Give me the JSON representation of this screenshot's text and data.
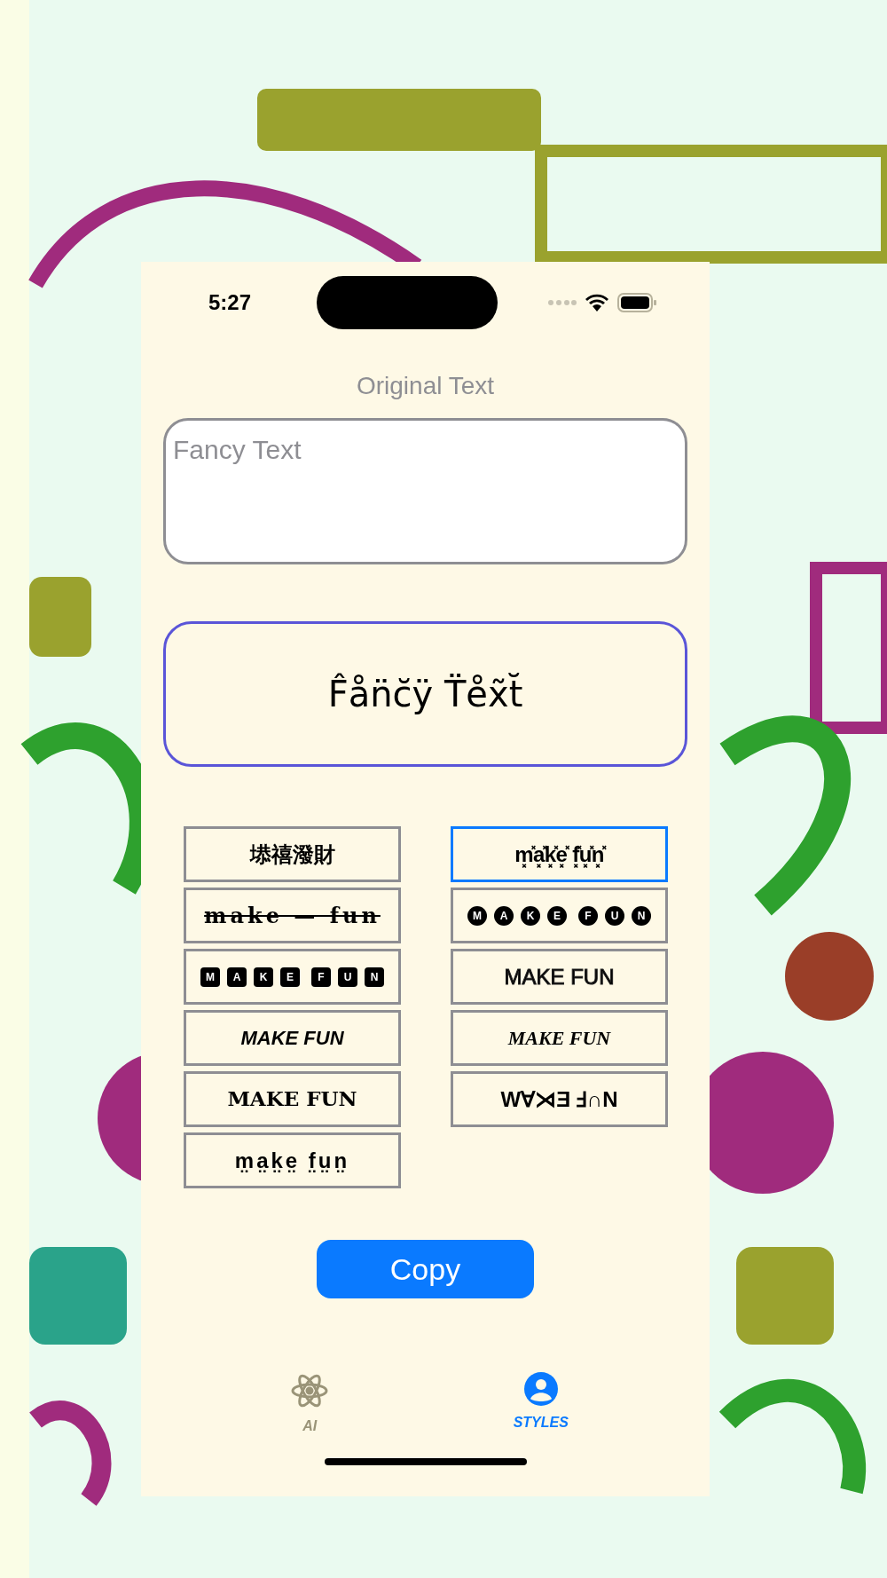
{
  "status_bar": {
    "time": "5:27"
  },
  "original_label": "Original Text",
  "input": {
    "placeholder": "Fancy Text"
  },
  "output": "F̂ån̈c̆ÿ T̈e̊x̃t̆",
  "styles": [
    {
      "kind": "cjk",
      "text": "塨禧潑財",
      "selected": false
    },
    {
      "kind": "strike",
      "text": "make — fun",
      "selected": false
    },
    {
      "kind": "squared",
      "text": "M A K E  F U N",
      "selected": false
    },
    {
      "kind": "italic",
      "text": "MAKE FUN",
      "selected": false
    },
    {
      "kind": "blackletter",
      "text": "MAKE FUN",
      "selected": false
    },
    {
      "kind": "dotted",
      "text": "m̤a̤k̤e̤ f̤ṳn̤",
      "selected": false
    },
    {
      "kind": "zalgo",
      "text": "m͓̽a͓̽k͓̽e͓̽ f͓̽u͓̽n͓̽",
      "selected": true
    },
    {
      "kind": "circled",
      "text": "M A K E  F U N",
      "selected": false
    },
    {
      "kind": "outline",
      "text": "MAKE FUN",
      "selected": false
    },
    {
      "kind": "script",
      "text": "MAKE FUN",
      "selected": false
    },
    {
      "kind": "flipped",
      "text": "W∀⋊Ǝ Ⅎ∩N",
      "selected": false
    }
  ],
  "copy_button": "Copy",
  "tabs": [
    {
      "label": "AI",
      "kind": "atom",
      "selected": false
    },
    {
      "label": "STYLES",
      "kind": "person",
      "selected": true
    }
  ]
}
